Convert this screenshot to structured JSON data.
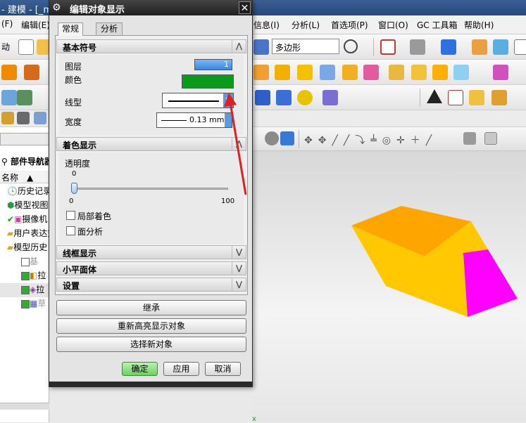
{
  "app": {
    "title_fragment": "- 建模 - [_m"
  },
  "menubar": {
    "left_items": [
      "(F)",
      "编辑(E)"
    ],
    "right_items": [
      "信息(I)",
      "分析(L)",
      "首选项(P)",
      "窗口(O)",
      "GC 工具箱",
      "帮助(H)"
    ]
  },
  "toolbar": {
    "left_label": "动",
    "filter_value": "多边形"
  },
  "navigator": {
    "title": "部件导航器",
    "column_header": "名称",
    "items": [
      "历史记录",
      "模型视图",
      "摄像机",
      "用户表达式",
      "模型历史",
      "基",
      "拉",
      "拉",
      "草"
    ]
  },
  "dialog": {
    "title": "编辑对象显示",
    "close_glyph": "✕",
    "tabs": [
      "常规",
      "分析"
    ],
    "basic_section": {
      "header": "基本符号",
      "layer_label": "图层",
      "layer_value": "1",
      "color_label": "颜色",
      "color": "#0a9a1e",
      "linetype_label": "线型",
      "width_label": "宽度",
      "width_value": "0.13 mm"
    },
    "shade_section": {
      "header": "着色显示",
      "transparency_label": "透明度",
      "slider_value": "0",
      "slider_min": "0",
      "slider_max": "100",
      "slider_fraction": 0,
      "partial_shade_label": "局部着色",
      "face_analysis_label": "面分析"
    },
    "collapsed_sections": [
      "线框显示",
      "小平面体",
      "设置"
    ],
    "buttons": {
      "inherit": "继承",
      "rehighlight": "重新高亮显示对象",
      "select_new": "选择新对象",
      "ok": "确定",
      "apply": "应用",
      "cancel": "取消"
    }
  },
  "model": {
    "top_face_color": "#ffa500",
    "left_face_color": "#ffbf55",
    "front_face_color": "#ffc800",
    "right_face_color": "#ff00ff"
  },
  "annotation": {
    "arrow_color": "#e02020"
  }
}
